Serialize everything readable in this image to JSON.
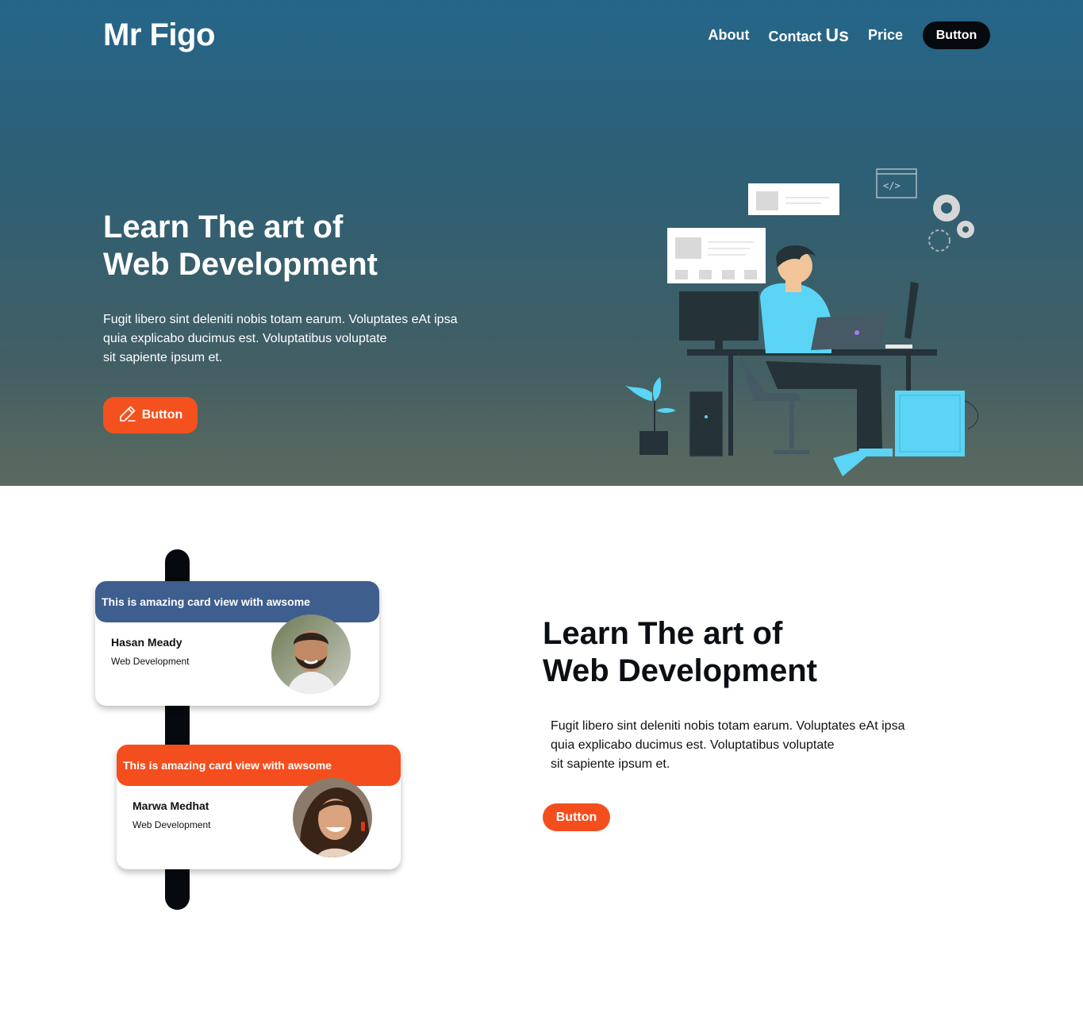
{
  "header": {
    "logo": "Mr Figo",
    "nav": {
      "about": "About",
      "contact_main": "Contact",
      "contact_us": "Us",
      "price": "Price",
      "button": "Button"
    }
  },
  "hero": {
    "title_line1": "Learn The art of",
    "title_line2": "Web Development",
    "description": "Fugit libero sint deleniti nobis totam earum. Voluptates eAt ipsa\nquia explicabo ducimus est. Voluptatibus voluptate\nsit sapiente ipsum et.",
    "button_label": "Button",
    "button_icon": "pencil-icon",
    "illustration": "developer-at-desk-illustration"
  },
  "cards": [
    {
      "header": "This is amazing card view with awsome",
      "name": "Hasan Meady",
      "role": "Web Development",
      "header_color": "#3e5e8e"
    },
    {
      "header": "This is amazing card view with awsome",
      "name": "Marwa Medhat",
      "role": "Web Development",
      "header_color": "#f44e1e"
    }
  ],
  "section2": {
    "title_line1": "Learn The art of",
    "title_line2": "Web Development",
    "description": "Fugit libero sint deleniti nobis totam earum. Voluptates eAt ipsa\nquia explicabo ducimus est. Voluptatibus voluptate\nsit sapiente ipsum et.",
    "button_label": "Button"
  },
  "colors": {
    "accent": "#f4511e",
    "dark": "#06090e",
    "card_blue": "#3e5e8e"
  }
}
